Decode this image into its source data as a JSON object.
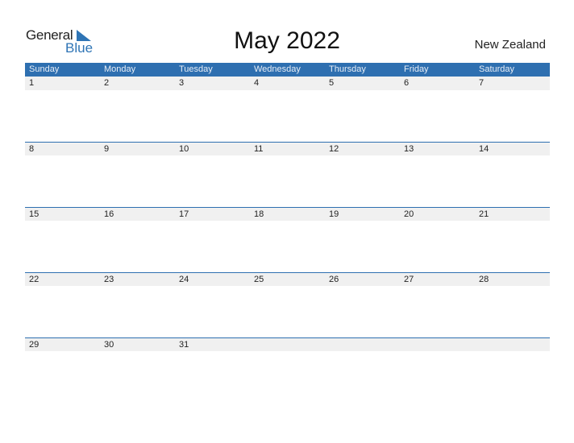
{
  "logo": {
    "line1": "General",
    "line2": "Blue"
  },
  "title": "May 2022",
  "country": "New Zealand",
  "colors": {
    "accent": "#2e6fb0",
    "band": "#f0f0f0"
  },
  "weekdays": [
    "Sunday",
    "Monday",
    "Tuesday",
    "Wednesday",
    "Thursday",
    "Friday",
    "Saturday"
  ],
  "weeks": [
    [
      "1",
      "2",
      "3",
      "4",
      "5",
      "6",
      "7"
    ],
    [
      "8",
      "9",
      "10",
      "11",
      "12",
      "13",
      "14"
    ],
    [
      "15",
      "16",
      "17",
      "18",
      "19",
      "20",
      "21"
    ],
    [
      "22",
      "23",
      "24",
      "25",
      "26",
      "27",
      "28"
    ],
    [
      "29",
      "30",
      "31",
      "",
      "",
      "",
      ""
    ]
  ]
}
